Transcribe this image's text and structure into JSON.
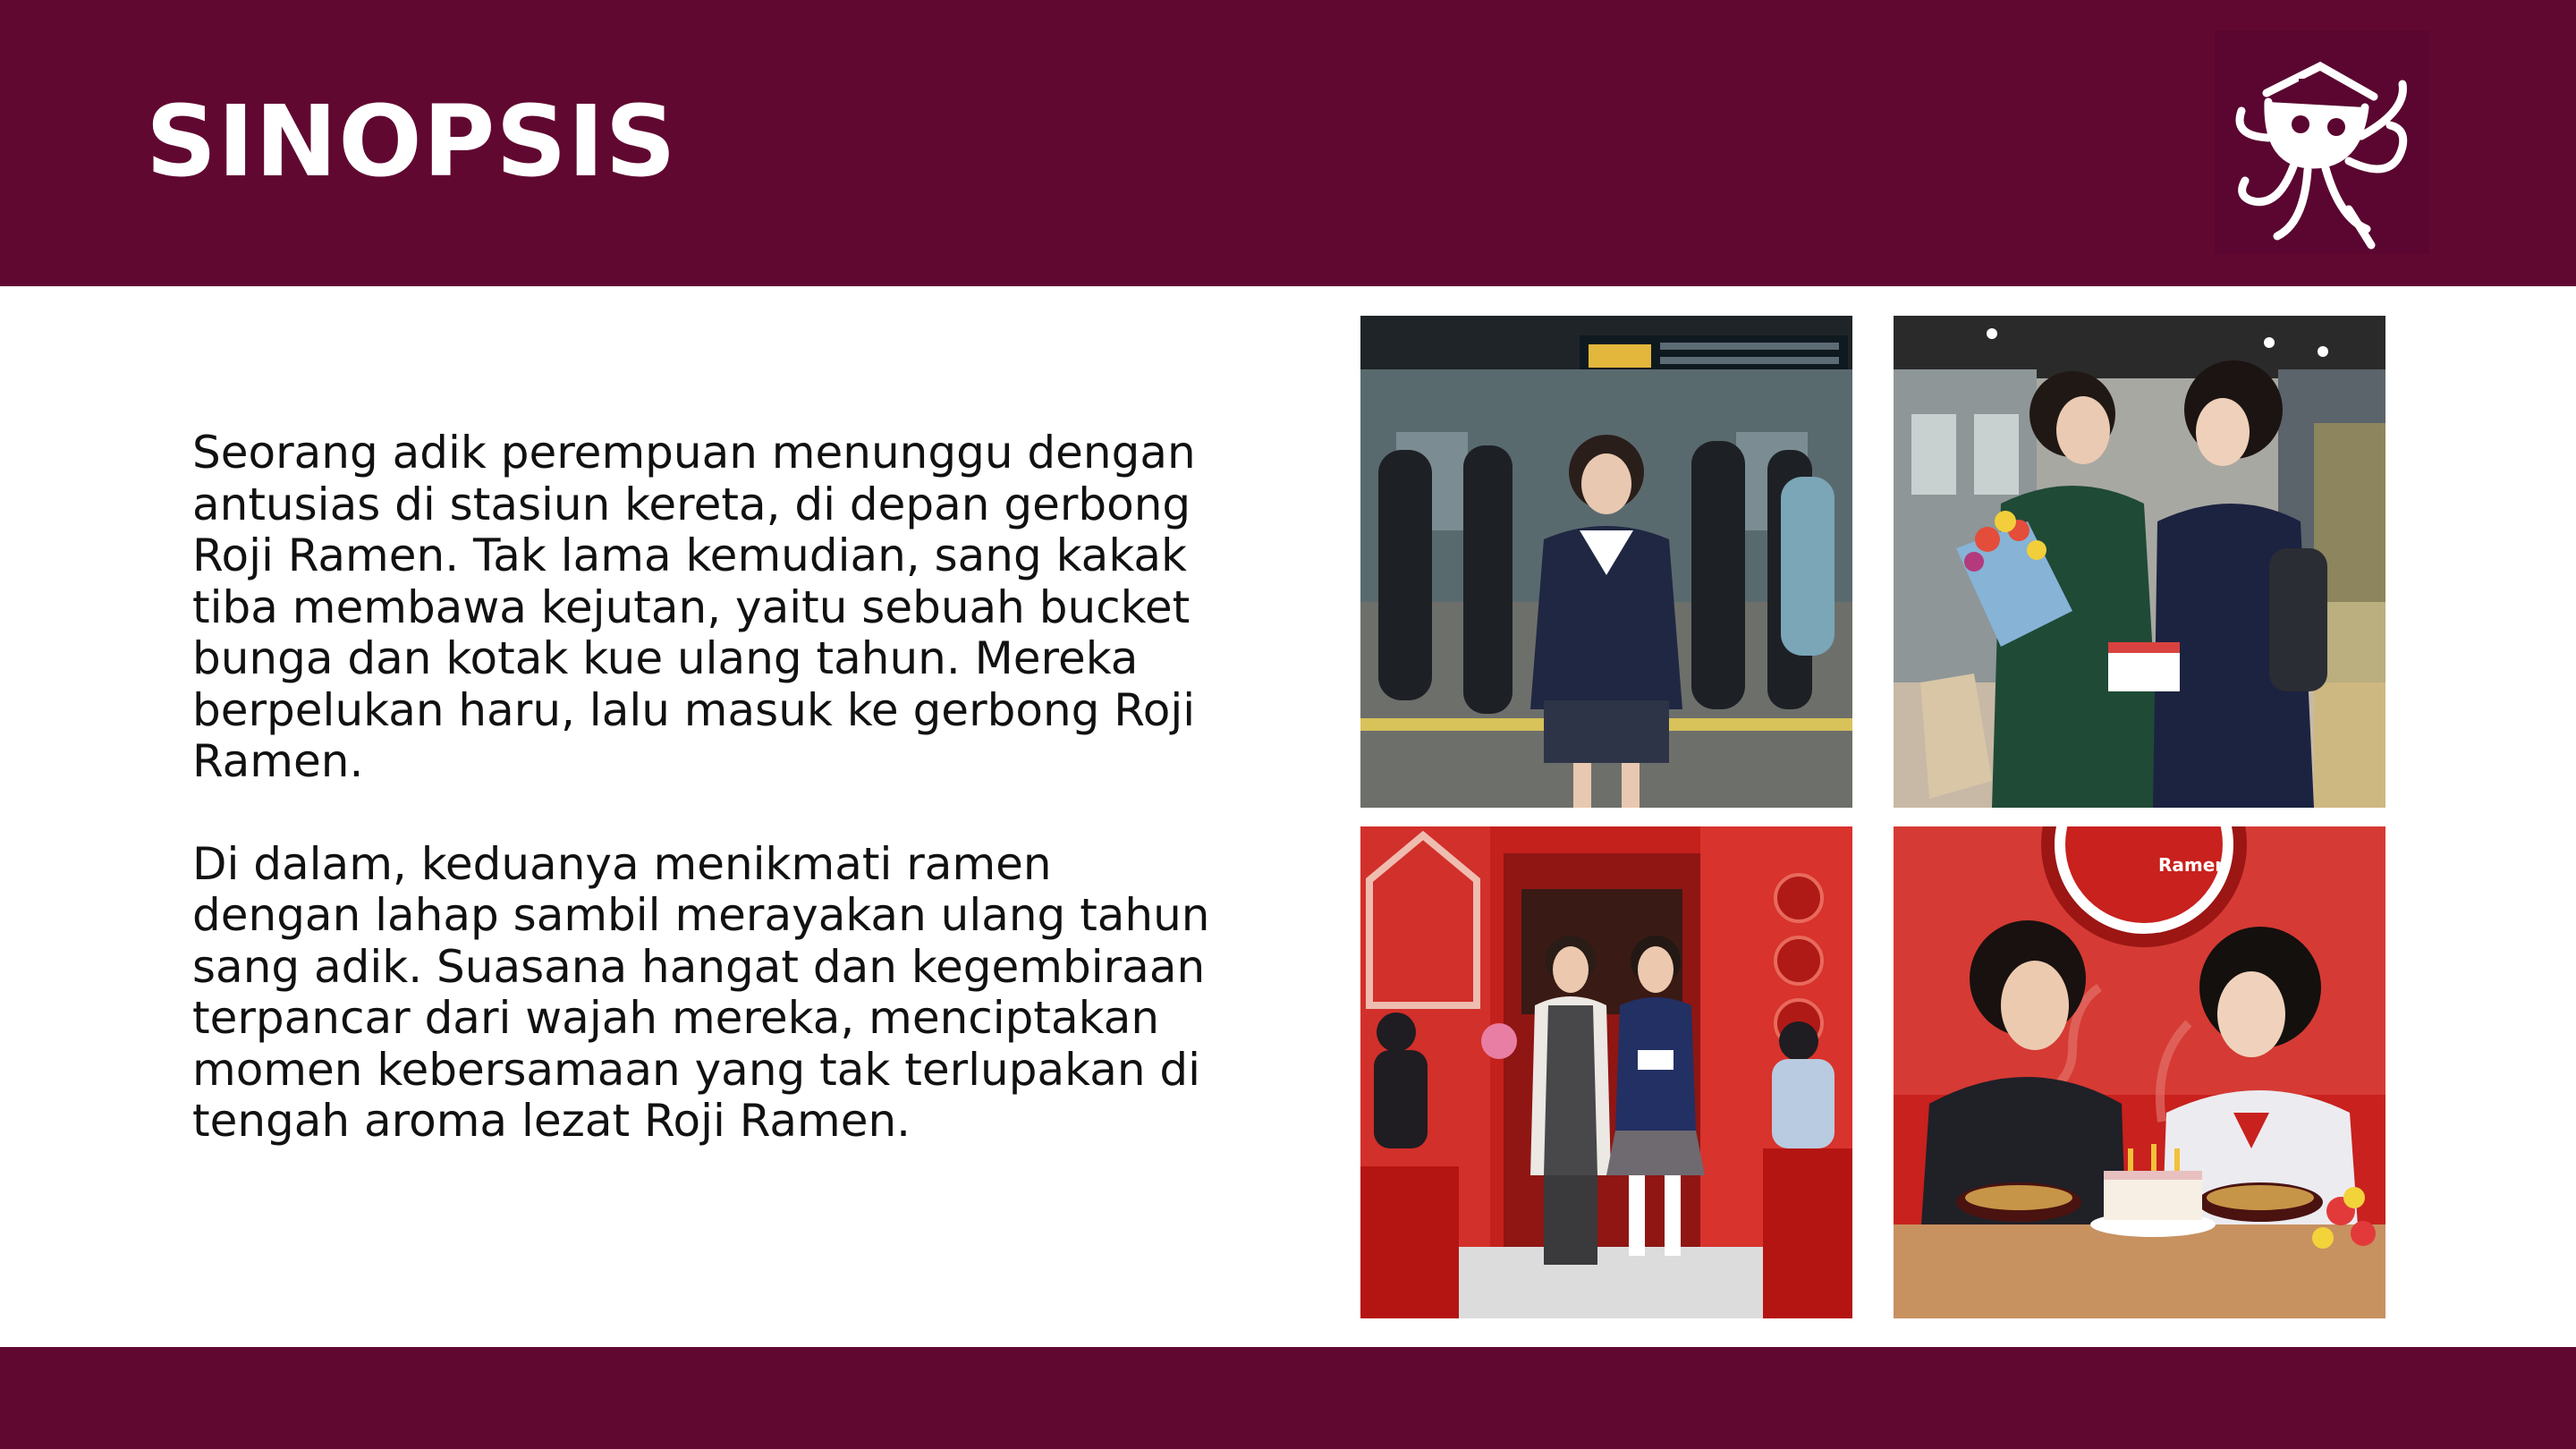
{
  "slide": {
    "title": "SINOPSIS",
    "paragraphs": [
      "Seorang adik perempuan menunggu dengan antusias di stasiun kereta, di depan gerbong Roji Ramen. Tak lama kemudian, sang kakak tiba membawa kejutan, yaitu sebuah bucket bunga dan kotak kue ulang tahun. Mereka berpelukan haru, lalu masuk ke gerbong Roji Ramen.",
      "Di dalam, keduanya menikmati ramen dengan lahap sambil merayakan ulang tahun sang adik. Suasana hangat dan kegembiraan terpancar dari wajah mereka, menciptakan momen kebersamaan yang tak terlupakan di tengah aroma lezat Roji Ramen."
    ]
  },
  "photos": {
    "sign_text": "Ramen"
  },
  "colors": {
    "brand": "#610831",
    "text": "#111111",
    "background": "#ffffff"
  },
  "icons": {
    "logo": "octopus-chef-logo-icon"
  }
}
